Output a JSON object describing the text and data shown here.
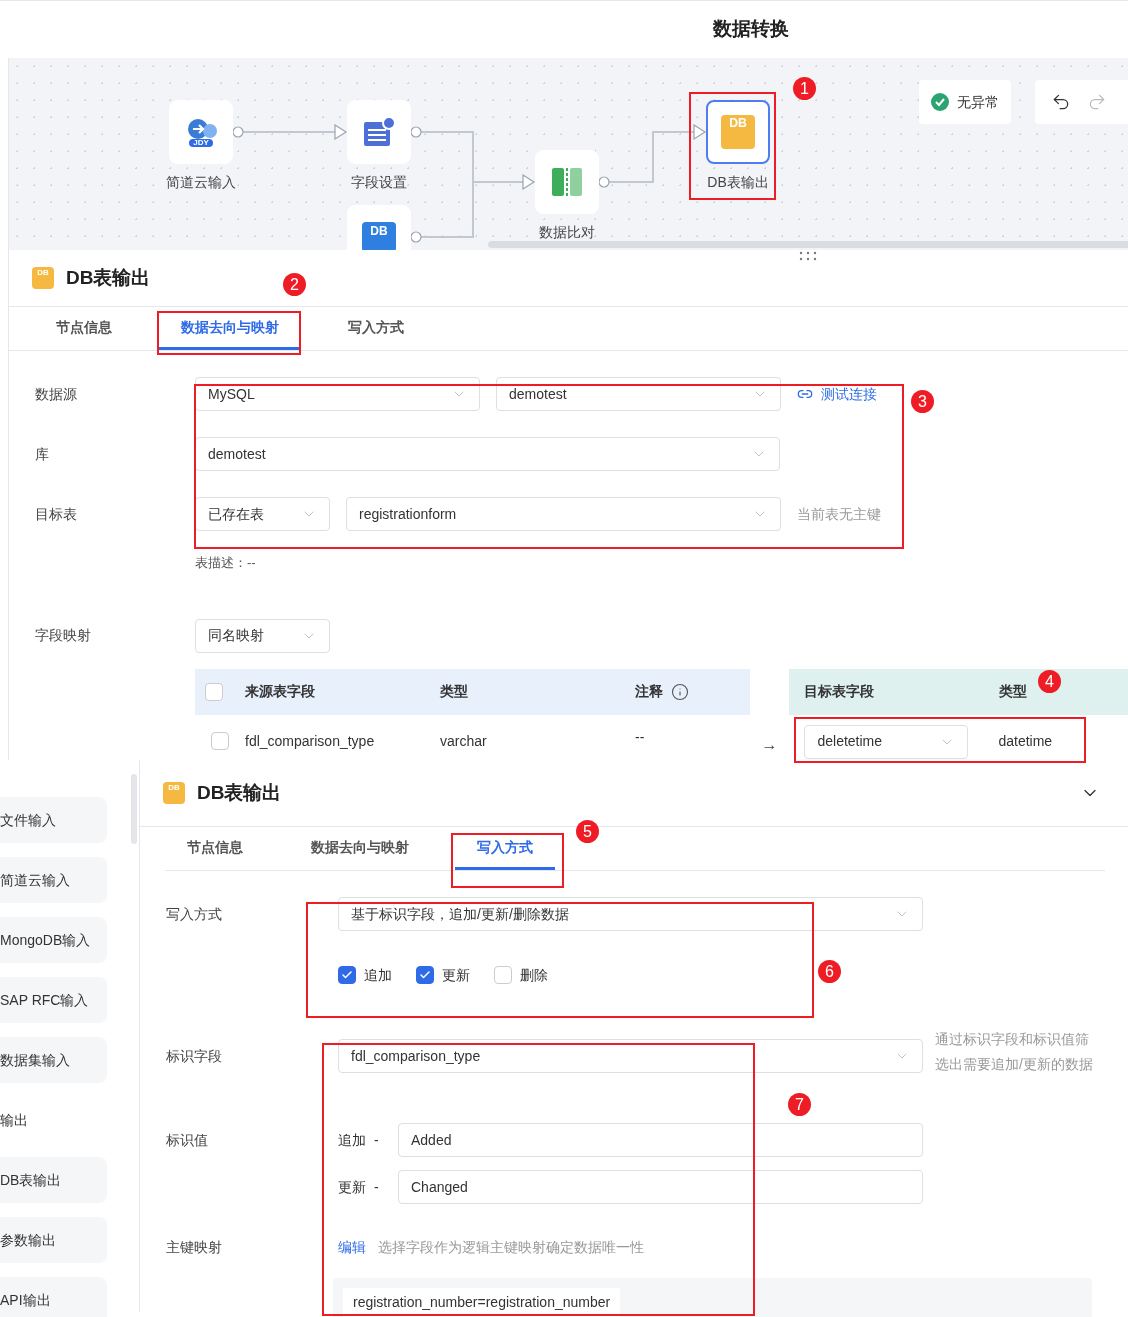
{
  "flow": {
    "title": "数据转换",
    "status": "无异常",
    "nodes": [
      {
        "label": "简道云输入",
        "kind": "jdy",
        "icon_text": "JDY",
        "selected": false
      },
      {
        "label": "字段设置",
        "kind": "fields",
        "selected": false
      },
      {
        "label": "数据比对",
        "kind": "compare",
        "selected": false
      },
      {
        "label": "DB表输出",
        "kind": "db",
        "icon_text": "DB",
        "selected": true
      },
      {
        "kind": "dbin",
        "icon_text": "DB",
        "selected": false
      }
    ]
  },
  "mapping_panel": {
    "title": "DB表输出",
    "icon_text": "DB",
    "tabs": [
      {
        "label": "节点信息",
        "selected": false
      },
      {
        "label": "数据去向与映射",
        "selected": true
      },
      {
        "label": "写入方式",
        "selected": false
      }
    ],
    "datasource_label": "数据源",
    "datasource": "MySQL",
    "connection": "demotest",
    "test_link": "测试连接",
    "database_label": "库",
    "database": "demotest",
    "target_label": "目标表",
    "target_mode": "已存在表",
    "target_table": "registrationform",
    "target_hint": "当前表无主键",
    "description": "表描述：--",
    "field_mapping_label": "字段映射",
    "field_mapping": "同名映射",
    "select_all_checked": false,
    "source_columns": [
      "来源表字段",
      "类型",
      "注释"
    ],
    "source_rows": [
      {
        "field": "fdl_comparison_type",
        "type": "varchar",
        "comment": "--",
        "checked": false
      }
    ],
    "arrow": "→",
    "target_columns": [
      "目标表字段",
      "类型"
    ],
    "target_rows": [
      {
        "field": "deletetime",
        "type": "datetime"
      }
    ]
  },
  "sidebar": {
    "items": [
      {
        "label": "文件输入",
        "kind": "item"
      },
      {
        "label": "简道云输入",
        "kind": "item"
      },
      {
        "label": "MongoDB输入",
        "kind": "item"
      },
      {
        "label": "SAP RFC输入",
        "kind": "item"
      },
      {
        "label": "数据集输入",
        "kind": "item"
      },
      {
        "label": "输出",
        "kind": "group"
      },
      {
        "label": "DB表输出",
        "kind": "item"
      },
      {
        "label": "参数输出",
        "kind": "item"
      },
      {
        "label": "API输出",
        "kind": "item"
      }
    ]
  },
  "write_panel": {
    "title": "DB表输出",
    "icon_text": "DB",
    "tabs": [
      {
        "label": "节点信息",
        "selected": false
      },
      {
        "label": "数据去向与映射",
        "selected": false
      },
      {
        "label": "写入方式",
        "selected": true
      }
    ],
    "mode_label": "写入方式",
    "mode": "基于标识字段，追加/更新/删除数据",
    "options": [
      {
        "label": "追加",
        "checked": true
      },
      {
        "label": "更新",
        "checked": true
      },
      {
        "label": "删除",
        "checked": false
      }
    ],
    "key_field_label": "标识字段",
    "key_field": "fdl_comparison_type",
    "key_help": "通过标识字段和标识值筛选出需要追加/更新的数据",
    "key_value_label": "标识值",
    "key_values": [
      {
        "label": "追加",
        "dash": "-",
        "value": "Added"
      },
      {
        "label": "更新",
        "dash": "-",
        "value": "Changed"
      }
    ],
    "pk_label": "主键映射",
    "pk_edit": "编辑",
    "pk_hint": "选择字段作为逻辑主键映射确定数据唯一性",
    "pk_tags": [
      "registration_number=registration_number"
    ]
  },
  "annotations": [
    "1",
    "2",
    "3",
    "4",
    "5",
    "6",
    "7"
  ]
}
